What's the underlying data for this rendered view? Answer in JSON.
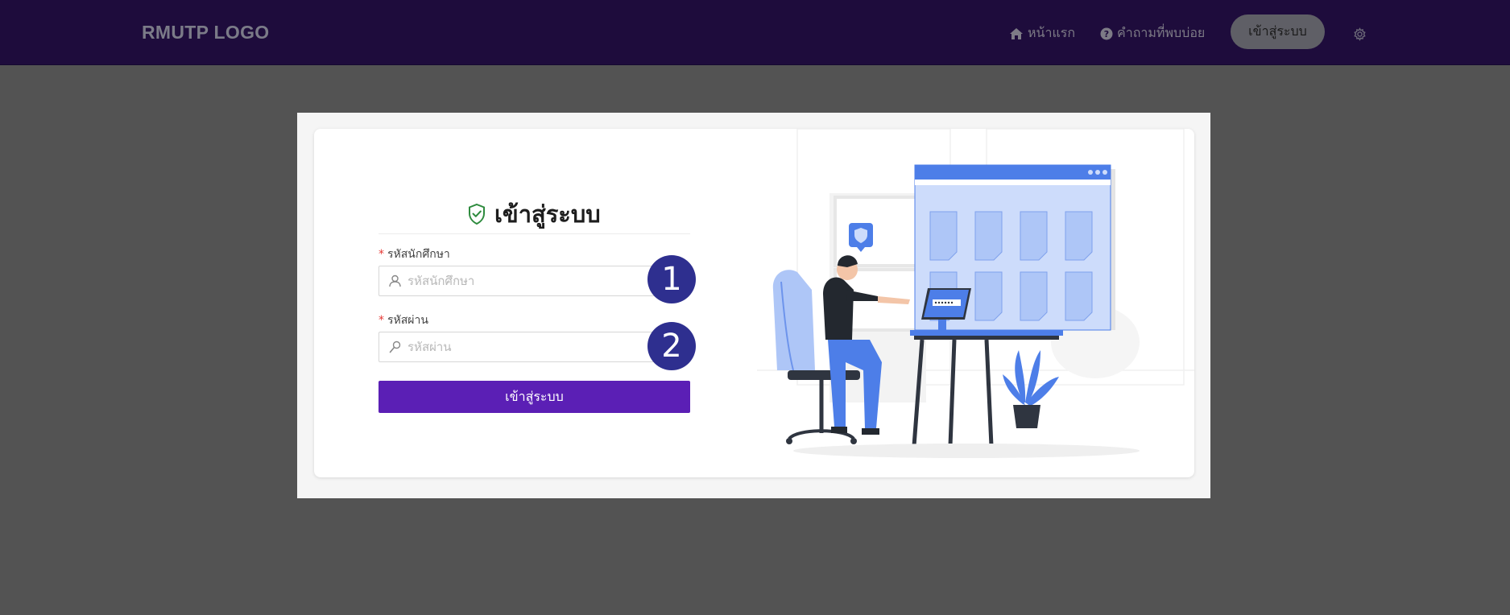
{
  "header": {
    "logo": "RMUTP LOGO",
    "nav": {
      "home": "หน้าแรก",
      "faq": "คำถามที่พบบ่อย",
      "login": "เข้าสู่ระบบ"
    }
  },
  "login_form": {
    "title": "เข้าสู่ระบบ",
    "required_mark": "*",
    "student_id_label": "รหัสนักศึกษา",
    "student_id_placeholder": "รหัสนักศึกษา",
    "password_label": "รหัสผ่าน",
    "password_placeholder": "รหัสผ่าน",
    "submit_label": "เข้าสู่ระบบ"
  },
  "annotations": [
    "1",
    "2"
  ],
  "colors": {
    "navbar": "#1e0c3c",
    "backdrop": "#535353",
    "primary_button": "#5b1fb5",
    "badge": "#2e2f8f",
    "illustration_accent": "#4d7ee8",
    "title_icon": "#2e8b3e"
  },
  "icons": {
    "home": "home-icon",
    "faq": "question-circle-icon",
    "settings": "gear-icon",
    "title": "shield-check-icon",
    "user": "user-icon",
    "password": "key-icon"
  }
}
